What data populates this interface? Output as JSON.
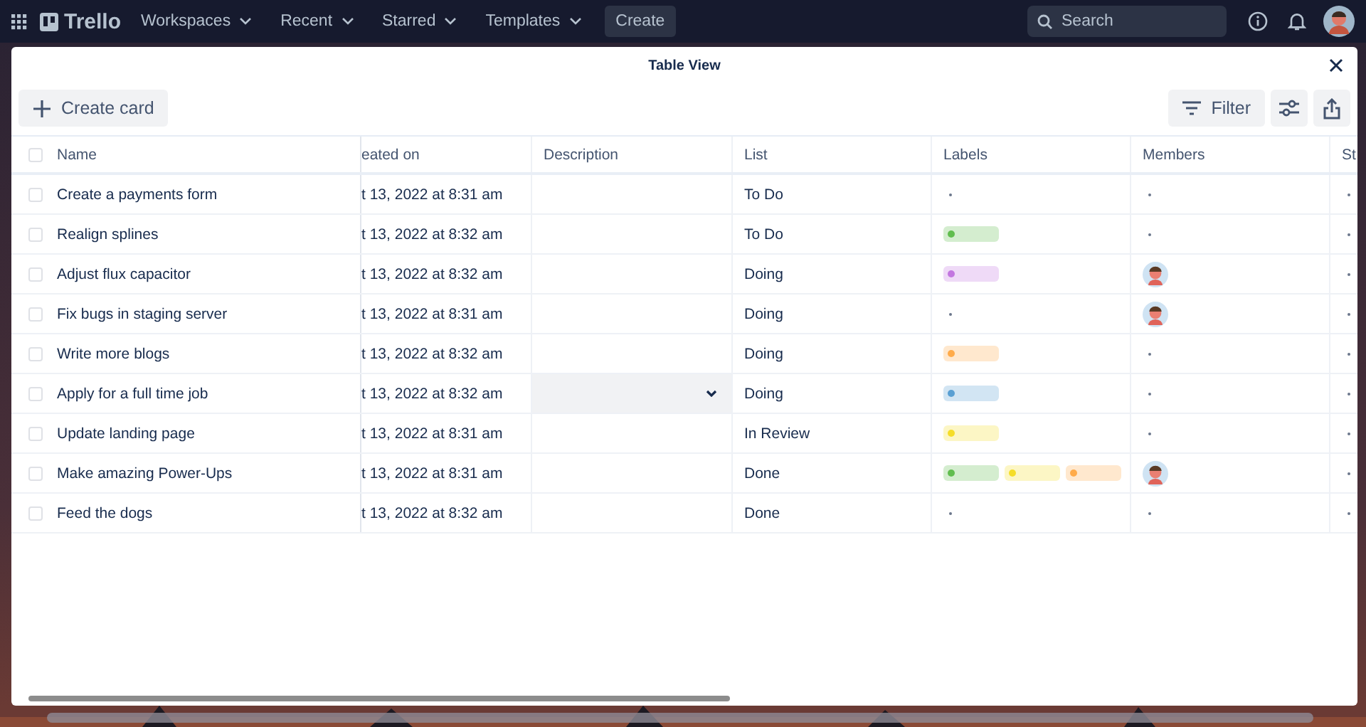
{
  "nav": {
    "logo": "Trello",
    "menus": [
      "Workspaces",
      "Recent",
      "Starred",
      "Templates"
    ],
    "create": "Create",
    "search": {
      "placeholder": "Search"
    }
  },
  "modal": {
    "title": "Table View",
    "create_card": "Create card",
    "filter": "Filter"
  },
  "table": {
    "all_checked": false,
    "columns": [
      "Name",
      "eated on",
      "Description",
      "List",
      "Labels",
      "Members",
      "St"
    ],
    "rows": [
      {
        "name": "Create a payments form",
        "created": "t 13, 2022 at 8:31 am",
        "list": "To Do",
        "labels": [],
        "member": false,
        "hovered": false,
        "checked": false
      },
      {
        "name": "Realign splines",
        "created": "t 13, 2022 at 8:32 am",
        "list": "To Do",
        "labels": [
          {
            "color": "#61bd4f"
          }
        ],
        "member": false,
        "hovered": false,
        "checked": false
      },
      {
        "name": "Adjust flux capacitor",
        "created": "t 13, 2022 at 8:32 am",
        "list": "Doing",
        "labels": [
          {
            "color": "#c377e0"
          }
        ],
        "member": true,
        "hovered": false,
        "checked": false
      },
      {
        "name": "Fix bugs in staging server",
        "created": "t 13, 2022 at 8:31 am",
        "list": "Doing",
        "labels": [],
        "member": true,
        "hovered": false,
        "checked": false
      },
      {
        "name": "Write more blogs",
        "created": "t 13, 2022 at 8:32 am",
        "list": "Doing",
        "labels": [
          {
            "color": "#ffab4a"
          }
        ],
        "member": false,
        "hovered": false,
        "checked": false
      },
      {
        "name": "Apply for a full time job",
        "created": "t 13, 2022 at 8:32 am",
        "list": "Doing",
        "labels": [
          {
            "color": "#5aa0d3"
          }
        ],
        "member": false,
        "hovered": true,
        "checked": false
      },
      {
        "name": "Update landing page",
        "created": "t 13, 2022 at 8:31 am",
        "list": "In Review",
        "labels": [
          {
            "color": "#f5dd29"
          }
        ],
        "member": false,
        "hovered": false,
        "checked": false
      },
      {
        "name": "Make amazing Power-Ups",
        "created": "t 13, 2022 at 8:31 am",
        "list": "Done",
        "labels": [
          {
            "color": "#61bd4f"
          },
          {
            "color": "#f5dd29"
          },
          {
            "color": "#ffab4a"
          }
        ],
        "member": true,
        "hovered": false,
        "checked": false
      },
      {
        "name": "Feed the dogs",
        "created": "t 13, 2022 at 8:32 am",
        "list": "Done",
        "labels": [],
        "member": false,
        "hovered": false,
        "checked": false
      }
    ]
  }
}
